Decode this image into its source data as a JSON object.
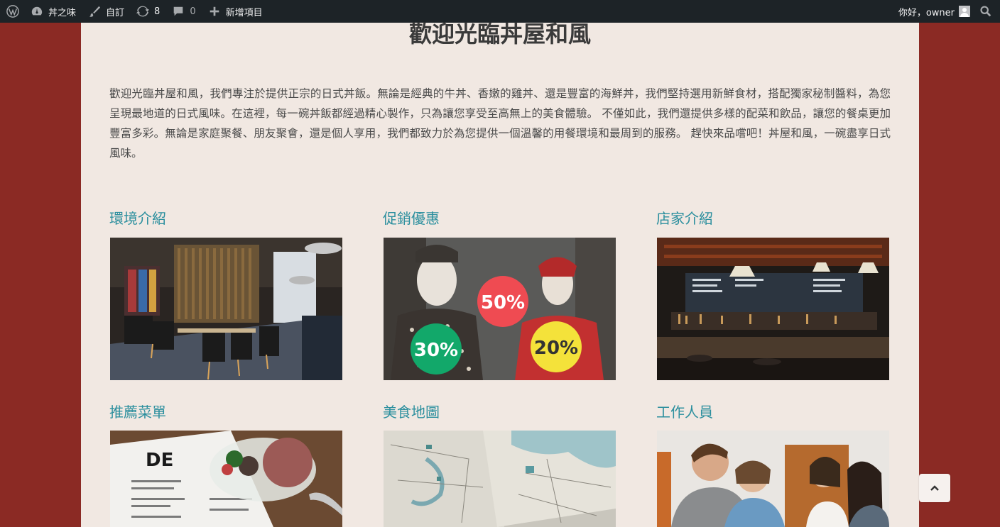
{
  "adminbar": {
    "site_name": "丼之味",
    "customize_label": "自訂",
    "updates_count": "8",
    "comments_count": "0",
    "new_item_label": "新增項目",
    "greeting": "你好，owner"
  },
  "page": {
    "title": "歡迎光臨丼屋和風",
    "intro": "歡迎光臨丼屋和風，我們專注於提供正宗的日式丼飯。無論是經典的牛丼、香嫩的雞丼、還是豐富的海鮮丼，我們堅持選用新鮮食材，搭配獨家秘制醬料，為您呈現最地道的日式風味。在這裡，每一碗丼飯都經過精心製作，只為讓您享受至高無上的美食體驗。 不僅如此，我們還提供多樣的配菜和飲品，讓您的餐桌更加豐富多彩。無論是家庭聚餐、朋友聚會，還是個人享用，我們都致力於為您提供一個溫馨的用餐環境和最周到的服務。 趕快來品嚐吧！丼屋和風，一碗盡享日式風味。"
  },
  "cards": [
    {
      "title": "環境介紹"
    },
    {
      "title": "促銷優惠",
      "badges": [
        "50%",
        "30%",
        "20%"
      ]
    },
    {
      "title": "店家介紹"
    },
    {
      "title": "推薦菜單",
      "menu_text": "DE"
    },
    {
      "title": "美食地圖"
    },
    {
      "title": "工作人員"
    }
  ],
  "colors": {
    "background": "#8b2a24",
    "panel": "#f1e8e2",
    "heading_link": "#2c8f9e",
    "adminbar": "#1d2327"
  }
}
